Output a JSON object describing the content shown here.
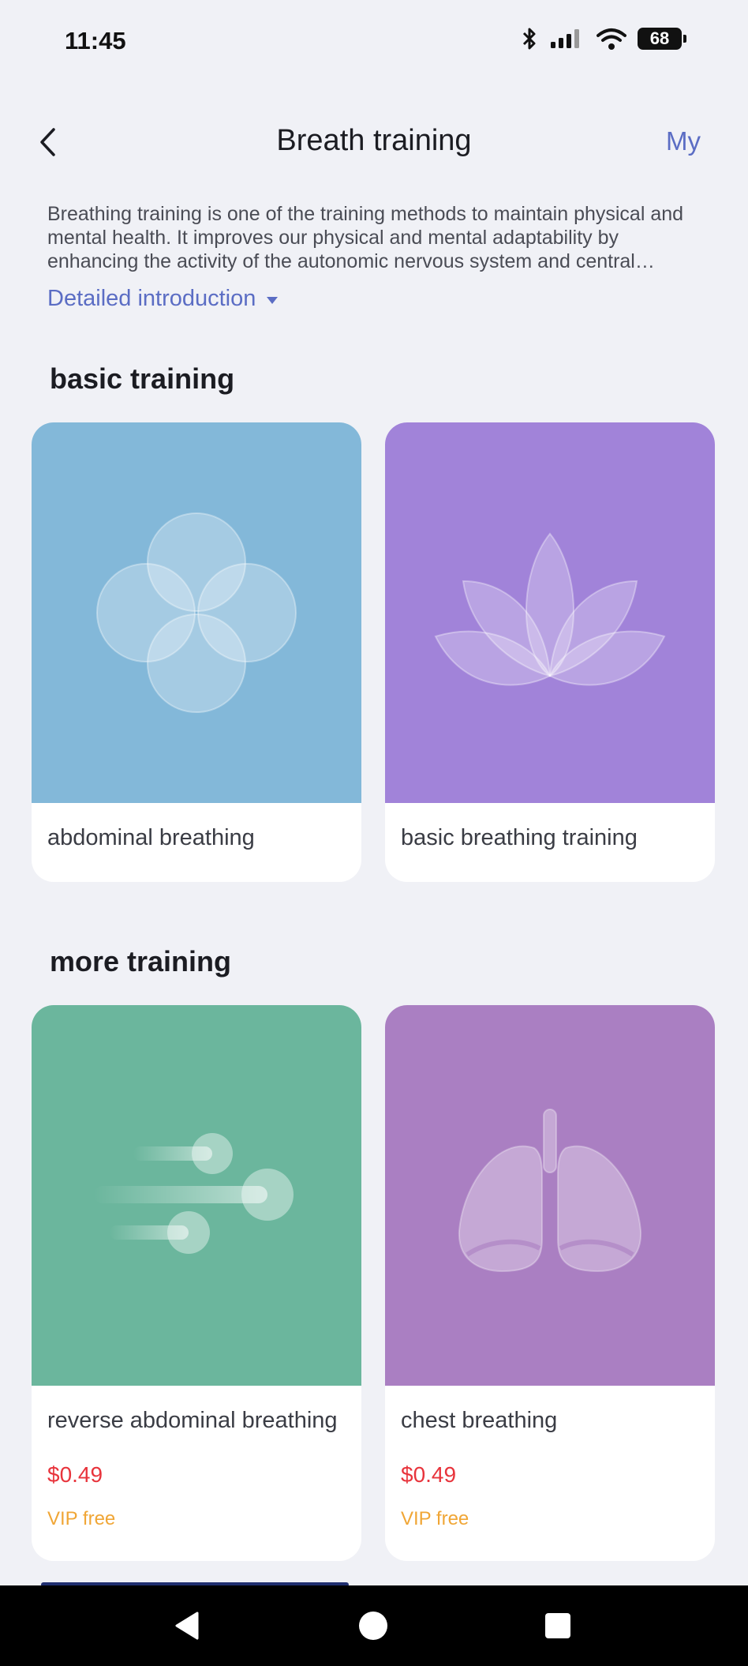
{
  "status": {
    "time": "11:45",
    "battery": "68"
  },
  "header": {
    "title": "Breath training",
    "my_label": "My"
  },
  "intro": {
    "text": "Breathing training is one of the training methods to maintain physical and mental health. It improves our physical and mental adaptability by enhancing the activity of the autonomic nervous system and central nervous system.",
    "detail_label": "Detailed introduction"
  },
  "sections": {
    "basic": {
      "title": "basic training",
      "cards": [
        {
          "name": "abdominal breathing",
          "color": "#83b8d9",
          "icon": "four-circles-icon"
        },
        {
          "name": "basic breathing training",
          "color": "#a183d9",
          "icon": "lotus-icon"
        }
      ]
    },
    "more": {
      "title": "more training",
      "cards": [
        {
          "name": "reverse abdominal breathing",
          "price": "$0.49",
          "vip": "VIP free",
          "color": "#6bb69d",
          "icon": "wind-icon"
        },
        {
          "name": "chest breathing",
          "price": "$0.49",
          "vip": "VIP free",
          "color": "#aa7fc2",
          "icon": "lungs-icon"
        }
      ]
    }
  }
}
